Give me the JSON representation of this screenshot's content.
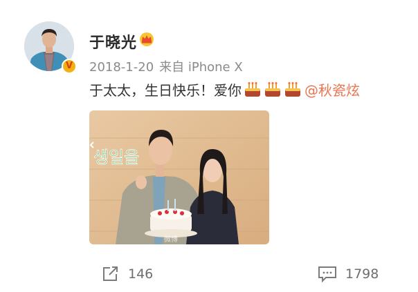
{
  "post": {
    "username": "于晓光",
    "date": "2018-1-20",
    "source": "来自 iPhone X",
    "text": "于太太，生日快乐！爱你",
    "cakes": 3,
    "mention": "@秋瓷炫",
    "photo": {
      "overlay_text": "생일을",
      "watermark": "微博"
    },
    "actions": {
      "repost_count": "146",
      "comment_count": "1798"
    }
  },
  "icons": {
    "verified": "verified-v-badge",
    "crown": "crown-icon",
    "cake": "birthday-cake-icon",
    "repost": "repost-icon",
    "comment": "comment-icon"
  },
  "colors": {
    "mention": "#eb7350",
    "verified_badge": "#f2b10f",
    "meta_text": "#8a8a8a"
  }
}
